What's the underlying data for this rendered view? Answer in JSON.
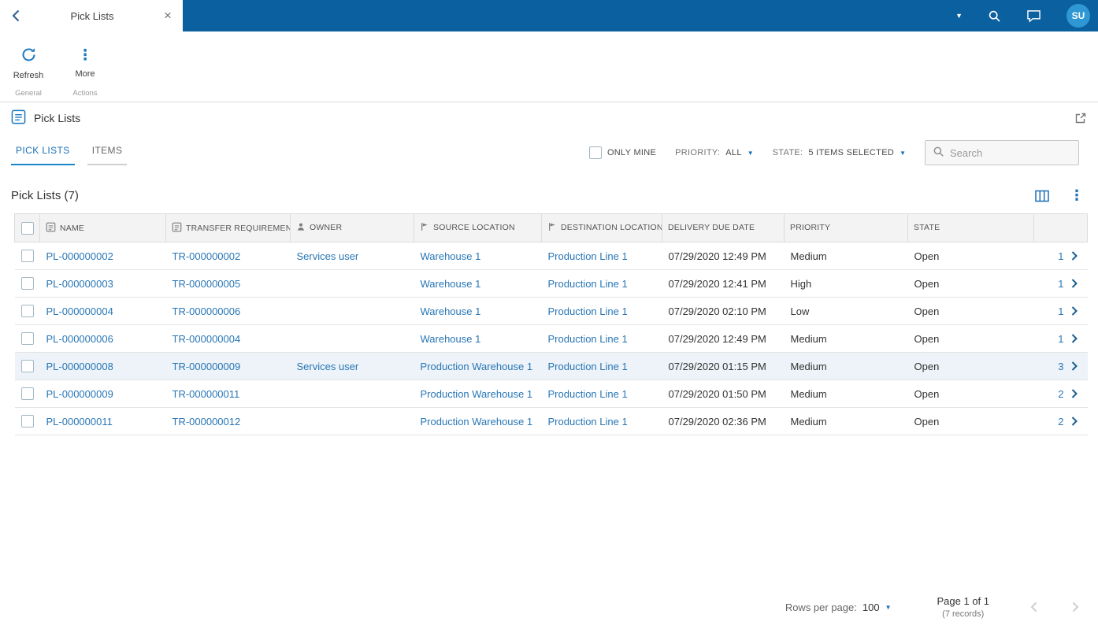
{
  "colors": {
    "topbar_blue": "#0b609f",
    "accent_blue": "#1a6fb5",
    "link_blue": "#2876b5",
    "avatar_blue": "#2e97d4",
    "selected_row_bg": "#edf3f8"
  },
  "icons": {
    "close": "×",
    "more": "⋮",
    "caret_down": "▼"
  },
  "topbar": {
    "tab_title": "Pick Lists",
    "avatar_initials": "SU"
  },
  "toolbar": {
    "refresh_label": "Refresh",
    "more_label": "More",
    "group_general": "General",
    "group_actions": "Actions"
  },
  "screen": {
    "title": "Pick Lists"
  },
  "tabs": {
    "pick_lists": "PICK LISTS",
    "items": "ITEMS"
  },
  "filters": {
    "only_mine_label": "ONLY MINE",
    "priority_label": "PRIORITY:",
    "priority_value": "ALL",
    "state_label": "STATE:",
    "state_value": "5 ITEMS SELECTED",
    "search_placeholder": "Search"
  },
  "grid": {
    "title": "Pick Lists (7)",
    "columns": {
      "name": "NAME",
      "transfer": "TRANSFER REQUIREMENT",
      "owner": "OWNER",
      "source": "SOURCE LOCATION",
      "destination": "DESTINATION LOCATION",
      "due": "DELIVERY DUE DATE",
      "priority": "PRIORITY",
      "state": "STATE"
    },
    "rows": [
      {
        "name": "PL-000000002",
        "transfer": "TR-000000002",
        "owner": "Services user",
        "source": "Warehouse 1",
        "destination": "Production Line 1",
        "due": "07/29/2020 12:49 PM",
        "priority": "Medium",
        "state": "Open",
        "count": "1",
        "selected": false
      },
      {
        "name": "PL-000000003",
        "transfer": "TR-000000005",
        "owner": "",
        "source": "Warehouse 1",
        "destination": "Production Line 1",
        "due": "07/29/2020 12:41 PM",
        "priority": "High",
        "state": "Open",
        "count": "1",
        "selected": false
      },
      {
        "name": "PL-000000004",
        "transfer": "TR-000000006",
        "owner": "",
        "source": "Warehouse 1",
        "destination": "Production Line 1",
        "due": "07/29/2020 02:10 PM",
        "priority": "Low",
        "state": "Open",
        "count": "1",
        "selected": false
      },
      {
        "name": "PL-000000006",
        "transfer": "TR-000000004",
        "owner": "",
        "source": "Warehouse 1",
        "destination": "Production Line 1",
        "due": "07/29/2020 12:49 PM",
        "priority": "Medium",
        "state": "Open",
        "count": "1",
        "selected": false
      },
      {
        "name": "PL-000000008",
        "transfer": "TR-000000009",
        "owner": "Services user",
        "source": "Production Warehouse 1",
        "destination": "Production Line 1",
        "due": "07/29/2020 01:15 PM",
        "priority": "Medium",
        "state": "Open",
        "count": "3",
        "selected": true
      },
      {
        "name": "PL-000000009",
        "transfer": "TR-000000011",
        "owner": "",
        "source": "Production Warehouse 1",
        "destination": "Production Line 1",
        "due": "07/29/2020 01:50 PM",
        "priority": "Medium",
        "state": "Open",
        "count": "2",
        "selected": false
      },
      {
        "name": "PL-000000011",
        "transfer": "TR-000000012",
        "owner": "",
        "source": "Production Warehouse 1",
        "destination": "Production Line 1",
        "due": "07/29/2020 02:36 PM",
        "priority": "Medium",
        "state": "Open",
        "count": "2",
        "selected": false
      }
    ]
  },
  "footer": {
    "rows_per_page_label": "Rows per page:",
    "rows_per_page_value": "100",
    "page_label": "Page 1 of 1",
    "records_label": "(7 records)"
  }
}
